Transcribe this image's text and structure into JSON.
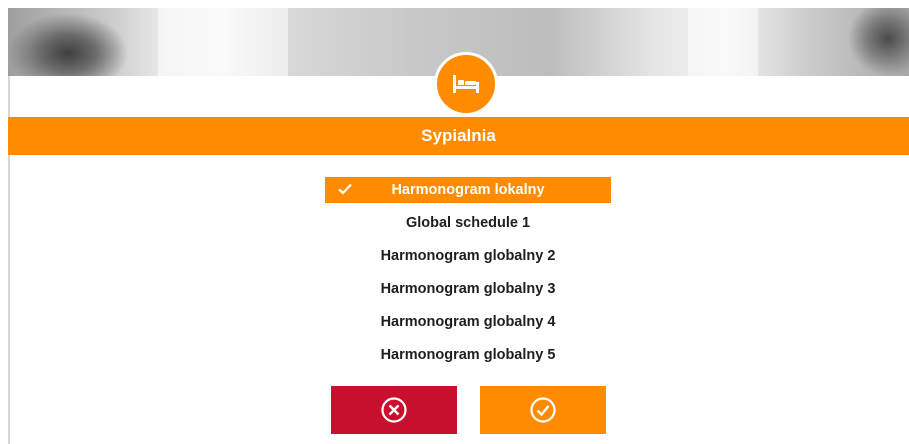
{
  "dialog": {
    "title": "Sypialnia",
    "room_icon": "bed-icon"
  },
  "schedules": [
    {
      "label": "Harmonogram lokalny",
      "selected": true
    },
    {
      "label": "Global schedule 1",
      "selected": false
    },
    {
      "label": "Harmonogram globalny 2",
      "selected": false
    },
    {
      "label": "Harmonogram globalny 3",
      "selected": false
    },
    {
      "label": "Harmonogram globalny 4",
      "selected": false
    },
    {
      "label": "Harmonogram globalny 5",
      "selected": false
    }
  ],
  "buttons": {
    "cancel_icon": "close-circle-icon",
    "confirm_icon": "check-circle-icon"
  },
  "colors": {
    "accent": "#ff8c00",
    "cancel": "#c8102e",
    "text": "#1e1e1e",
    "on_accent": "#ffffff"
  }
}
